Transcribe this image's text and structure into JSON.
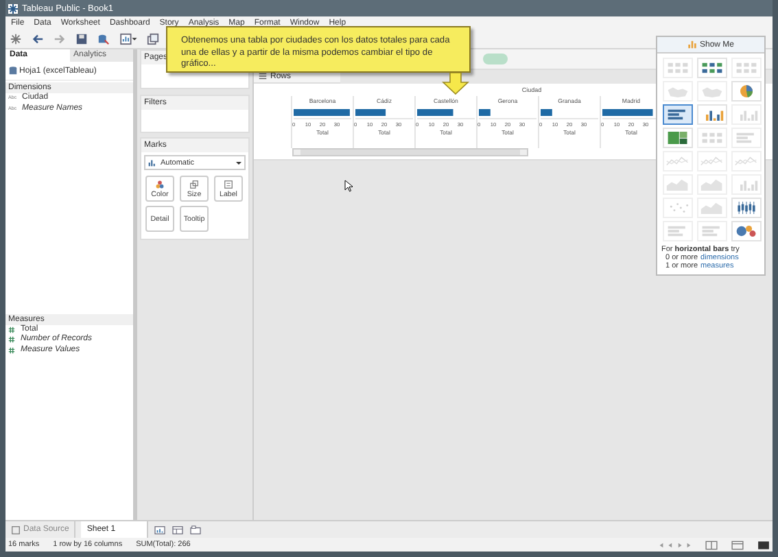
{
  "window": {
    "title": "Tableau Public - Book1"
  },
  "menu": [
    "File",
    "Data",
    "Worksheet",
    "Dashboard",
    "Story",
    "Analysis",
    "Map",
    "Format",
    "Window",
    "Help"
  ],
  "callout": {
    "text": "Obtenemos una tabla por ciudades con los datos totales para cada una de ellas y a partir de la misma podemos cambiar el tipo de gráfico..."
  },
  "data_pane": {
    "tabs": [
      {
        "label": "Data",
        "selected": true
      },
      {
        "label": "Analytics",
        "selected": false
      }
    ],
    "source": "Hoja1 (excelTableau)",
    "dimensions": {
      "title": "Dimensions",
      "items": [
        {
          "type_label": "Abc",
          "name": "Ciudad",
          "italic": false
        },
        {
          "type_label": "Abc",
          "name": "Measure Names",
          "italic": true
        }
      ]
    },
    "measures": {
      "title": "Measures",
      "items": [
        {
          "name": "Total",
          "italic": false
        },
        {
          "name": "Number of Records",
          "italic": true
        },
        {
          "name": "Measure Values",
          "italic": true
        }
      ]
    }
  },
  "cards": {
    "pages": "Pages",
    "filters": "Filters",
    "marks": {
      "title": "Marks",
      "mark_type": "Automatic",
      "buttons": [
        {
          "label": "Color",
          "kind": "color"
        },
        {
          "label": "Size",
          "kind": "size"
        },
        {
          "label": "Label",
          "kind": "label"
        },
        {
          "label": "Detail",
          "kind": "plain"
        },
        {
          "label": "Tooltip",
          "kind": "plain"
        }
      ]
    }
  },
  "rows_shelf": "Rows",
  "view": {
    "header": "Ciudad",
    "panels": [
      {
        "chart_data": {
          "type": "bar",
          "orientation": "horizontal",
          "title": "Barcelona",
          "xlabel": "Total",
          "values": [
            39
          ],
          "xlim": [
            0,
            40
          ],
          "xticks": [
            0,
            10,
            20,
            30
          ]
        }
      },
      {
        "chart_data": {
          "type": "bar",
          "orientation": "horizontal",
          "title": "Cádiz",
          "xlabel": "Total",
          "values": [
            21
          ],
          "xlim": [
            0,
            40
          ],
          "xticks": [
            0,
            10,
            20,
            30
          ]
        }
      },
      {
        "chart_data": {
          "type": "bar",
          "orientation": "horizontal",
          "title": "Castellón",
          "xlabel": "Total",
          "values": [
            25
          ],
          "xlim": [
            0,
            40
          ],
          "xticks": [
            0,
            10,
            20,
            30
          ]
        }
      },
      {
        "chart_data": {
          "type": "bar",
          "orientation": "horizontal",
          "title": "Gerona",
          "xlabel": "Total",
          "values": [
            8
          ],
          "xlim": [
            0,
            40
          ],
          "xticks": [
            0,
            10,
            20,
            30
          ]
        }
      },
      {
        "chart_data": {
          "type": "bar",
          "orientation": "horizontal",
          "title": "Granada",
          "xlabel": "Total",
          "values": [
            8
          ],
          "xlim": [
            0,
            40
          ],
          "xticks": [
            0,
            10,
            20,
            30
          ]
        }
      },
      {
        "chart_data": {
          "type": "bar",
          "orientation": "horizontal",
          "title": "Madrid",
          "xlabel": "Total",
          "values": [
            35
          ],
          "xlim": [
            0,
            40
          ],
          "xticks": [
            0,
            10,
            20,
            30
          ]
        }
      }
    ]
  },
  "show_me": {
    "title": "Show Me",
    "charts": [
      {
        "kind": "table",
        "enabled": false,
        "selected": false
      },
      {
        "kind": "table",
        "enabled": true,
        "selected": false
      },
      {
        "kind": "table",
        "enabled": false,
        "selected": false
      },
      {
        "kind": "map",
        "enabled": false,
        "selected": false
      },
      {
        "kind": "map",
        "enabled": false,
        "selected": false
      },
      {
        "kind": "pie",
        "enabled": true,
        "selected": false
      },
      {
        "kind": "hbar",
        "enabled": true,
        "selected": true
      },
      {
        "kind": "vbar",
        "enabled": true,
        "selected": false
      },
      {
        "kind": "vbar",
        "enabled": false,
        "selected": false
      },
      {
        "kind": "treemap",
        "enabled": true,
        "selected": false
      },
      {
        "kind": "table",
        "enabled": false,
        "selected": false
      },
      {
        "kind": "hbar",
        "enabled": false,
        "selected": false
      },
      {
        "kind": "line",
        "enabled": false,
        "selected": false
      },
      {
        "kind": "line",
        "enabled": false,
        "selected": false
      },
      {
        "kind": "line",
        "enabled": false,
        "selected": false
      },
      {
        "kind": "area",
        "enabled": false,
        "selected": false
      },
      {
        "kind": "area",
        "enabled": false,
        "selected": false
      },
      {
        "kind": "vbar",
        "enabled": false,
        "selected": false
      },
      {
        "kind": "scatter",
        "enabled": false,
        "selected": false
      },
      {
        "kind": "area",
        "enabled": false,
        "selected": false
      },
      {
        "kind": "box",
        "enabled": true,
        "selected": false
      },
      {
        "kind": "hbar",
        "enabled": false,
        "selected": false
      },
      {
        "kind": "hbar",
        "enabled": false,
        "selected": false
      },
      {
        "kind": "bubble",
        "enabled": true,
        "selected": false
      }
    ],
    "hint": "For **horizontal bars** try",
    "requirements": [
      {
        "count": "0 or more",
        "field": "dimensions"
      },
      {
        "count": "1 or more",
        "field": "measures"
      }
    ]
  },
  "sheet_tabs": [
    {
      "label": "Data Source",
      "kind": "source",
      "selected": false
    },
    {
      "label": "Sheet 1",
      "kind": "sheet",
      "selected": true
    }
  ],
  "status_bar": [
    "16 marks",
    "1 row by 16 columns",
    "SUM(Total): 266"
  ]
}
